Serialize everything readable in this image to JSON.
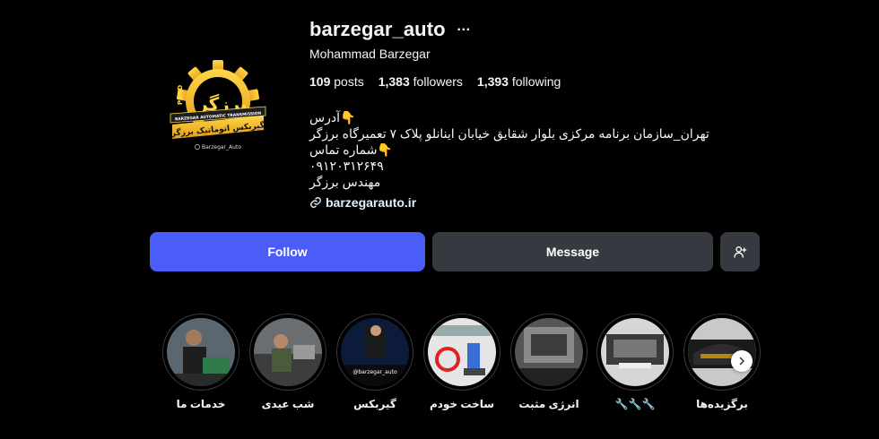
{
  "profile": {
    "username": "barzegar_auto",
    "more_icon": "…",
    "full_name": "Mohammad Barzegar",
    "stats": {
      "posts_count": "109",
      "posts_label": "posts",
      "followers_count": "1,383",
      "followers_label": "followers",
      "following_count": "1,393",
      "following_label": "following"
    },
    "bio_lines": [
      "👇آدرس",
      "تهران_سازمان برنامه مرکزی بلوار شقایق خیابان اینانلو پلاک ۷ تعمیرگاه برزگر",
      "👇شماره تماس",
      "۰۹۱۲۰۳۱۲۶۴۹",
      "مهندس برزگر"
    ],
    "link": "barzegarauto.ir"
  },
  "avatar": {
    "logo_text": "برزگر",
    "gear_text": "PRND",
    "band_text": "BARZEGAR AUTOMATIC TRANSMISSION",
    "banner_text": "گیربکس اتوماتیک برزگر",
    "handle_text": "Barzegar_Auto"
  },
  "actions": {
    "follow_label": "Follow",
    "message_label": "Message"
  },
  "highlights": [
    {
      "label": "برگزیده‌ها"
    },
    {
      "label": "🔧🔧🔧"
    },
    {
      "label": "انرژی مثبت"
    },
    {
      "label": "ساخت خودم"
    },
    {
      "label": "گیربکس",
      "thumb_text": "@barzegar_auto"
    },
    {
      "label": "شب عیدی"
    },
    {
      "label": "خدمات ما"
    }
  ],
  "colors": {
    "accent_blue": "#4a5df9",
    "secondary_button": "#363a40",
    "logo_gold": "#f2b31c"
  }
}
